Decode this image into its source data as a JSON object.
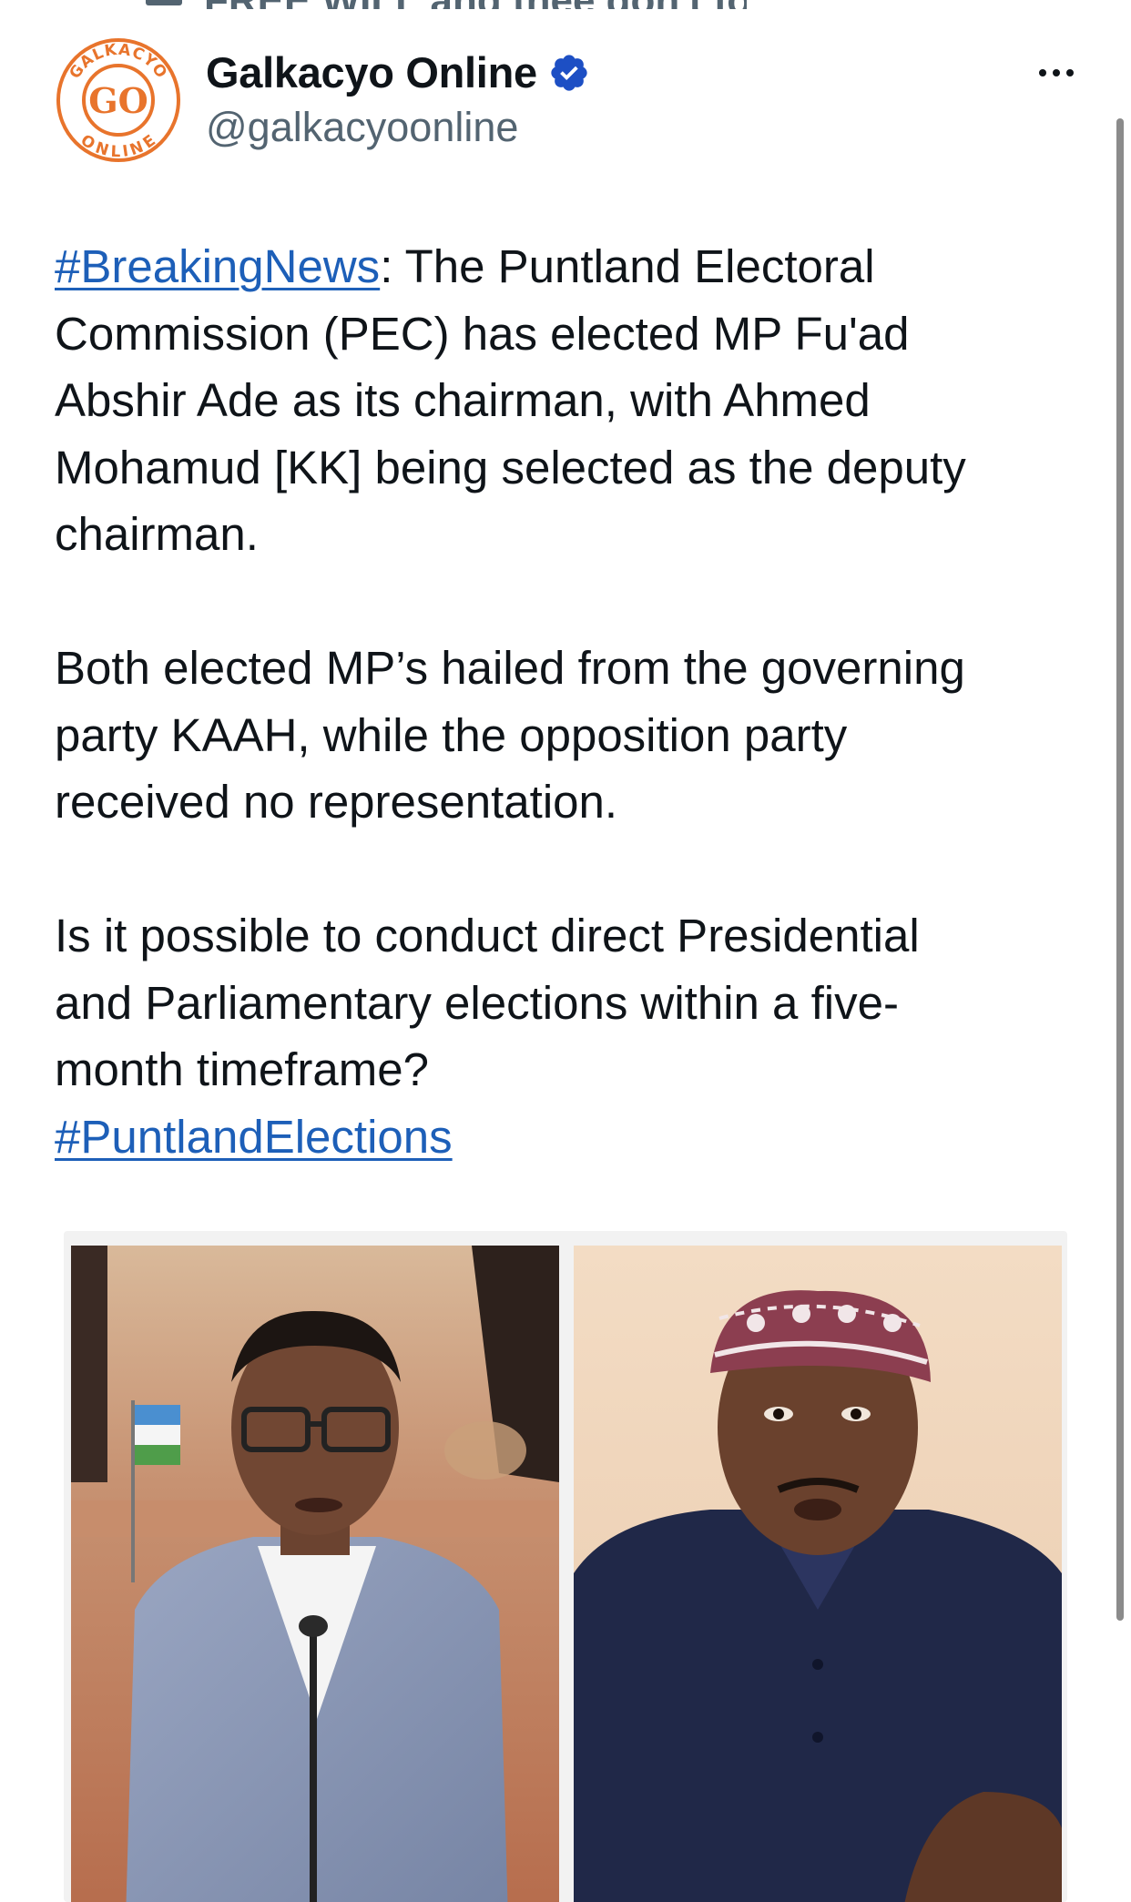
{
  "top_cut_text": "FREE WILL and thee don't follow",
  "tweet": {
    "display_name": "Galkacyo Online",
    "handle": "@galkacyoonline",
    "avatar_logo_text": "GALKACYO ONLINE",
    "paragraph1": {
      "hashtag": "#BreakingNews",
      "line1_rest": ": The Puntland Electoral",
      "line2": "Commission (PEC) has elected MP Fu'ad",
      "line3": "Abshir Ade as its chairman, with Ahmed",
      "line4": "Mohamud [KK] being selected as the deputy",
      "line5": "chairman."
    },
    "paragraph2": {
      "line1": "Both elected MP’s hailed from the governing",
      "line2": "party KAAH, while the opposition party",
      "line3": "received no representation."
    },
    "paragraph3": {
      "line1": "Is it possible to conduct direct Presidential",
      "line2": "and Parliamentary elections within a five-",
      "line3": "month timeframe?",
      "hashtag": "#PuntlandElections"
    }
  },
  "icons": {
    "verified": "verified-badge-icon",
    "more": "more-options-icon"
  },
  "colors": {
    "link": "#1d5fb8",
    "verified": "#1d4fc4",
    "logo_orange": "#e8742c",
    "secondary_text": "#536471"
  }
}
